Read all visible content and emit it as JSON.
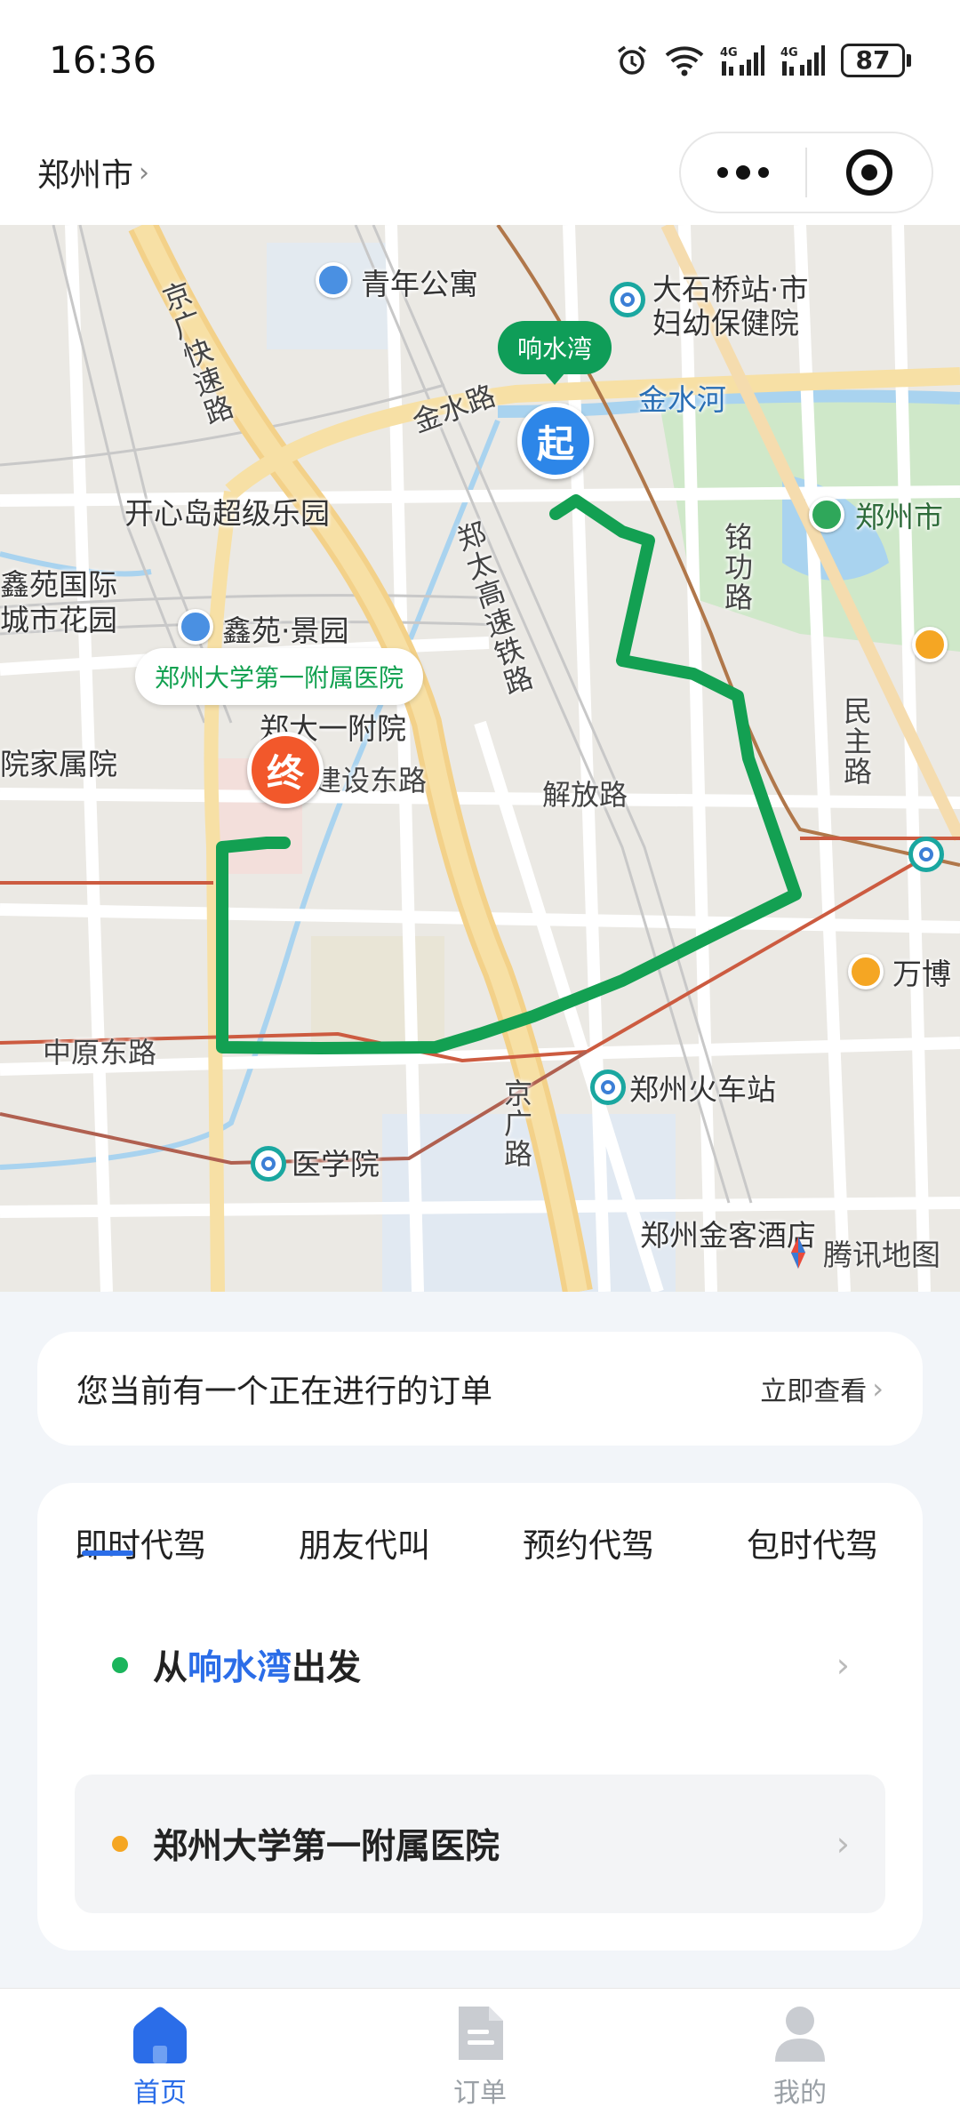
{
  "status_bar": {
    "time": "16:36",
    "battery": "87",
    "icons": [
      "alarm-icon",
      "wifi-icon",
      "signal-4g-icon",
      "signal-4g-icon",
      "battery-icon"
    ]
  },
  "top_nav": {
    "city": "郑州市",
    "chevron": "›",
    "more_icon": "more-dots-icon",
    "close_icon": "target-icon"
  },
  "map": {
    "labels": {
      "qingnian": "青年公寓",
      "dashiqiao": "大石桥站·市",
      "fuyou": "妇幼保健院",
      "jinshuihe": "金水河",
      "jinshuilu": "金水路",
      "jingguang_express": "京广快速路",
      "kaixindao": "开心岛超级乐园",
      "zhengzhou_park": "郑州市",
      "xinyuan_intl1": "鑫苑国际",
      "xinyuan_intl2": "城市花园",
      "xinyuan_jingyuan": "鑫苑·景园",
      "zhengda_yifuyuan": "郑大一附院",
      "yuanjiashu": "院家属院",
      "zhengtai_rail": "郑太高速铁路",
      "minggong": "铭功路",
      "minzhu": "民主路",
      "jianshe_east": "建设东路",
      "jiefang": "解放路",
      "wanbo": "万博",
      "zhongyuan_east": "中原东路",
      "zhengzhou_station": "郑州火车站",
      "yixueyuan": "医学院",
      "jingguang_road": "京广路",
      "jinke_hotel": "郑州金客酒店",
      "tencent_map": "腾讯地图"
    },
    "start_label": "响水湾",
    "start_pin": "起",
    "end_label": "郑州大学第一附属医院",
    "end_pin": "终",
    "route_color": "#13a052"
  },
  "order_notice": {
    "text": "您当前有一个正在进行的订单",
    "link": "立即查看",
    "chevron": "›"
  },
  "booking": {
    "tabs": [
      "即时代驾",
      "朋友代叫",
      "预约代驾",
      "包时代驾"
    ],
    "active_tab": "即时代驾",
    "from_prefix": "从",
    "from_place": "响水湾",
    "from_suffix": "出发",
    "destination": "郑州大学第一附属医院",
    "chevron": "›",
    "from_dot_color": "#1bb55c",
    "dest_dot_color": "#f5a623"
  },
  "bottom_nav": {
    "items": [
      {
        "label": "首页",
        "icon": "home-icon",
        "active": true
      },
      {
        "label": "订单",
        "icon": "order-icon",
        "active": false
      },
      {
        "label": "我的",
        "icon": "profile-icon",
        "active": false
      }
    ]
  }
}
